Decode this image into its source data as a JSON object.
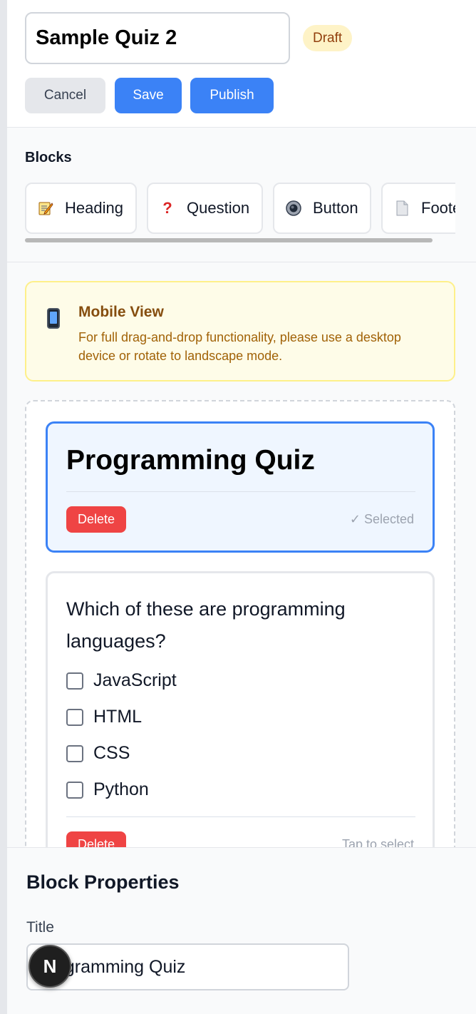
{
  "header": {
    "quiz_title": "Sample Quiz 2",
    "status_badge": "Draft",
    "cancel_label": "Cancel",
    "save_label": "Save",
    "publish_label": "Publish"
  },
  "blocks": {
    "title": "Blocks",
    "items": [
      {
        "label": "Heading",
        "icon": "memo-icon"
      },
      {
        "label": "Question",
        "icon": "question-mark-icon"
      },
      {
        "label": "Button",
        "icon": "radio-button-icon"
      },
      {
        "label": "Footer",
        "icon": "page-icon"
      }
    ]
  },
  "notice": {
    "title": "Mobile View",
    "text": "For full drag-and-drop functionality, please use a desktop device or rotate to landscape mode."
  },
  "canvas": {
    "heading_block": {
      "text": "Programming Quiz",
      "delete_label": "Delete",
      "state": "✓ Selected"
    },
    "question_block": {
      "question": "Which of these are programming languages?",
      "options": [
        "JavaScript",
        "HTML",
        "CSS",
        "Python"
      ],
      "delete_label": "Delete",
      "state": "Tap to select"
    }
  },
  "properties": {
    "title": "Block Properties",
    "field_label": "Title",
    "field_value": "Programming Quiz"
  },
  "fab": {
    "label": "N"
  },
  "colors": {
    "primary": "#3b82f6",
    "danger": "#ef4444",
    "badge_bg": "#fef3c7",
    "notice_bg": "#fefce8"
  }
}
